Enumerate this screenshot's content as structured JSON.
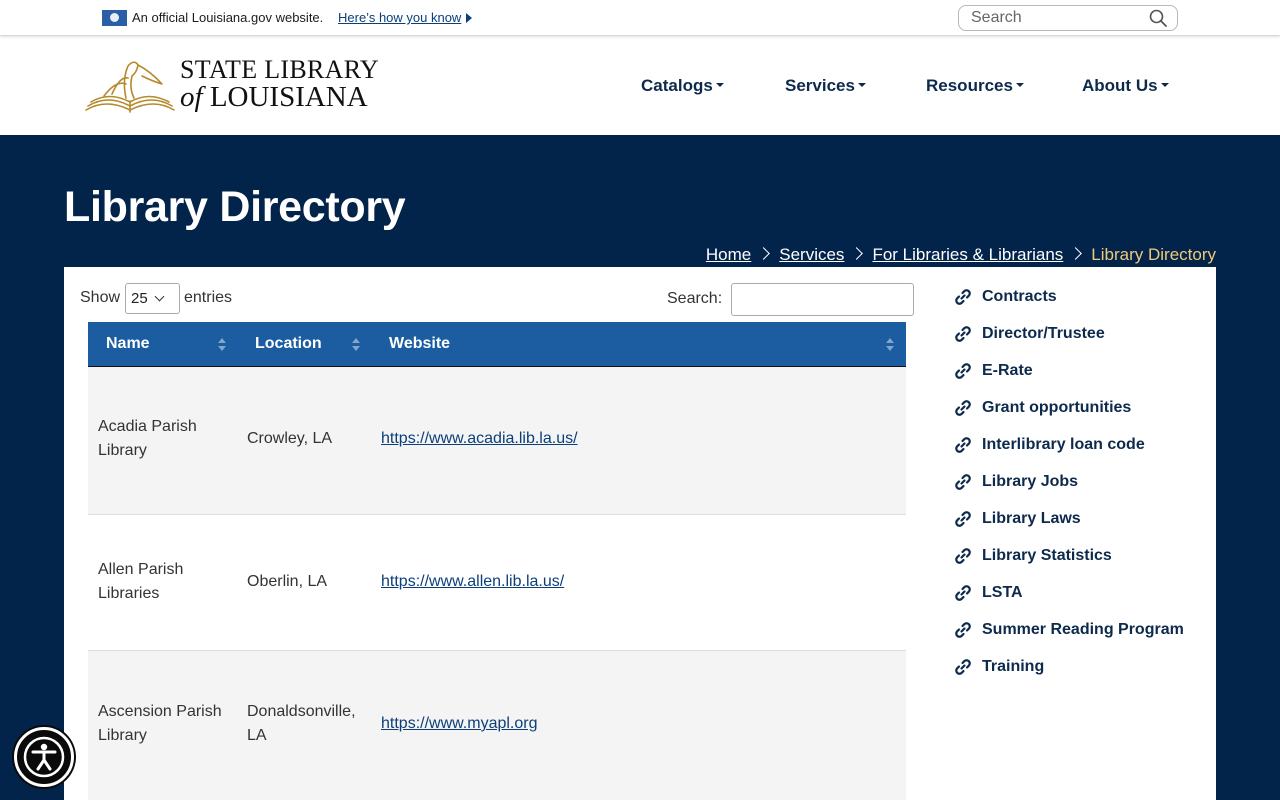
{
  "gov_banner": {
    "text": "An official Louisiana.gov website.",
    "link": "Here’s how you know",
    "search_placeholder": "Search"
  },
  "logo": {
    "line1": "STATE LIBRARY",
    "line2_of": "of",
    "line2_rest": "LOUISIANA"
  },
  "nav": [
    "Catalogs",
    "Services",
    "Resources",
    "About Us"
  ],
  "page": {
    "title": "Library Directory"
  },
  "breadcrumb": {
    "home": "Home",
    "services": "Services",
    "section": "For Libraries & Librarians",
    "current": "Library Directory"
  },
  "table_controls": {
    "show": "Show",
    "entries_value": "25",
    "entries": "entries",
    "search": "Search:"
  },
  "table": {
    "headers": [
      "Name",
      "Location",
      "Website"
    ],
    "rows": [
      {
        "name_1": "Acadia Parish",
        "name_2": "Library",
        "loc_1": "Crowley, LA",
        "loc_2": "",
        "url": "https://www.acadia.lib.la.us/"
      },
      {
        "name_1": "Allen Parish",
        "name_2": "Libraries",
        "loc_1": "Oberlin, LA",
        "loc_2": "",
        "url": "https://www.allen.lib.la.us/"
      },
      {
        "name_1": "Ascension Parish",
        "name_2": "Library",
        "loc_1": "Donaldsonville,",
        "loc_2": "LA",
        "url": "https://www.myapl.org"
      }
    ]
  },
  "sidebar": {
    "links": [
      "Contracts",
      "Director/Trustee",
      "E-Rate",
      "Grant opportunities",
      "Interlibrary loan code",
      "Library Jobs",
      "Library Laws",
      "Library Statistics",
      "LSTA",
      "Summer Reading Program",
      "Training"
    ]
  },
  "colors": {
    "navy": "#02234a",
    "table_header": "#1b5da0",
    "breadcrumb_current": "#f0c97a",
    "nav_text": "#0d2a4d"
  }
}
